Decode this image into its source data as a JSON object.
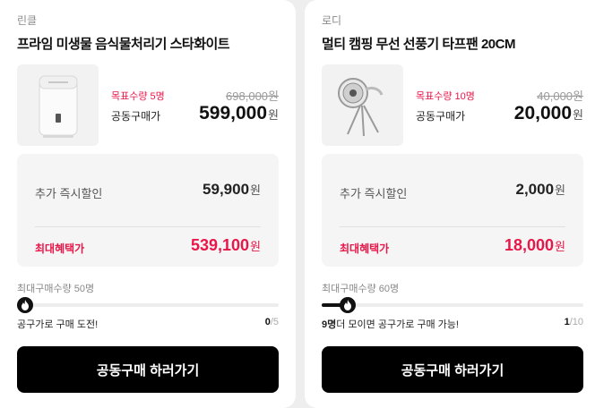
{
  "products": [
    {
      "brand": "린클",
      "title": "프라임 미생물 음식물처리기 스타화이트",
      "image": "food-waste-processor-image",
      "target_quantity": "목표수량 5명",
      "group_buy_label": "공동구매가",
      "original_price": "698,000원",
      "price": "599,000",
      "currency": "원",
      "extra_discount_label": "추가 즉시할인",
      "extra_discount_value": "59,900",
      "max_benefit_label": "최대혜택가",
      "max_benefit_value": "539,100",
      "max_quantity_label": "최대구매수량 50명",
      "progress": 0.0,
      "status_prefix": "",
      "status_text": "공구가로 구매 도전!",
      "count_current": "0",
      "count_total": "/5",
      "cta_label": "공동구매 하러가기"
    },
    {
      "brand": "로디",
      "title": "멀티 캠핑 무선 선풍기 타프팬 20CM",
      "image": "camping-fan-image",
      "target_quantity": "목표수량 10명",
      "group_buy_label": "공동구매가",
      "original_price": "40,000원",
      "price": "20,000",
      "currency": "원",
      "extra_discount_label": "추가 즉시할인",
      "extra_discount_value": "2,000",
      "max_benefit_label": "최대혜택가",
      "max_benefit_value": "18,000",
      "max_quantity_label": "최대구매수량 60명",
      "progress": 0.1,
      "status_prefix": "9명",
      "status_text": "더 모이면 공구가로 구매 가능!",
      "count_current": "1",
      "count_total": "/10",
      "cta_label": "공동구매 하러가기"
    }
  ],
  "colors": {
    "accent": "#e8174a",
    "button": "#000000",
    "panel": "#f5f5f5"
  },
  "icons": {
    "progress_knob": "flame-icon"
  }
}
